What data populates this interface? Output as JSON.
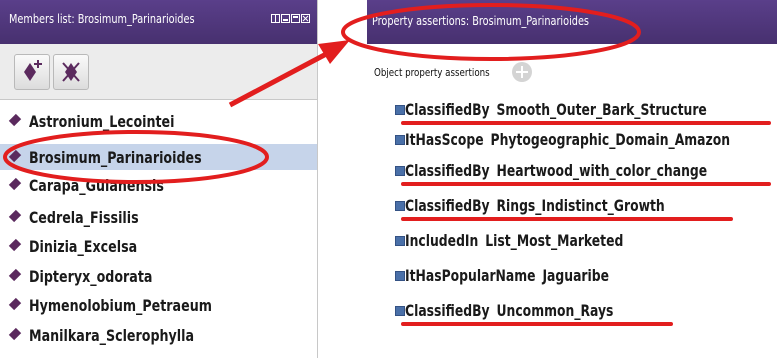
{
  "members_panel": {
    "title": "Members list: Brosimum_Parinarioides",
    "add_icon": "add-individual-icon",
    "delete_icon": "delete-individual-icon",
    "items": [
      {
        "label": "Astronium_Lecointei",
        "selected": false
      },
      {
        "label": "Brosimum_Parinarioides",
        "selected": true
      },
      {
        "label": "Carapa_Guianensis",
        "selected": false
      },
      {
        "label": "Cedrela_Fissilis",
        "selected": false
      },
      {
        "label": "Dinizia_Excelsa",
        "selected": false
      },
      {
        "label": "Dipteryx_odorata",
        "selected": false
      },
      {
        "label": "Hymenolobium_Petraeum",
        "selected": false
      },
      {
        "label": "Manilkara_Sclerophylla",
        "selected": false
      }
    ]
  },
  "properties_panel": {
    "title": "Property assertions: Brosimum_Parinarioides",
    "section_label": "Object property assertions",
    "add_icon": "add-icon",
    "assertions": [
      {
        "text": "ClassifiedBy  Smooth_Outer_Bark_Structure",
        "underlined": true
      },
      {
        "text": "ItHasScope  Phytogeographic_Domain_Amazon",
        "underlined": false
      },
      {
        "text": "ClassifiedBy  Heartwood_with_color_change",
        "underlined": true
      },
      {
        "text": "ClassifiedBy  Rings_Indistinct_Growth",
        "underlined": true
      },
      {
        "text": "IncludedIn  List_Most_Marketed",
        "underlined": false
      },
      {
        "text": "ItHasPopularName  Jaguaribe",
        "underlined": false
      },
      {
        "text": "ClassifiedBy  Uncommon_Rays",
        "underlined": true
      }
    ]
  },
  "colors": {
    "titlebar": "#4f3680",
    "selection": "#c6d4ea",
    "individual_diamond": "#5b2a5e",
    "annotation_red": "#e21e1e"
  }
}
